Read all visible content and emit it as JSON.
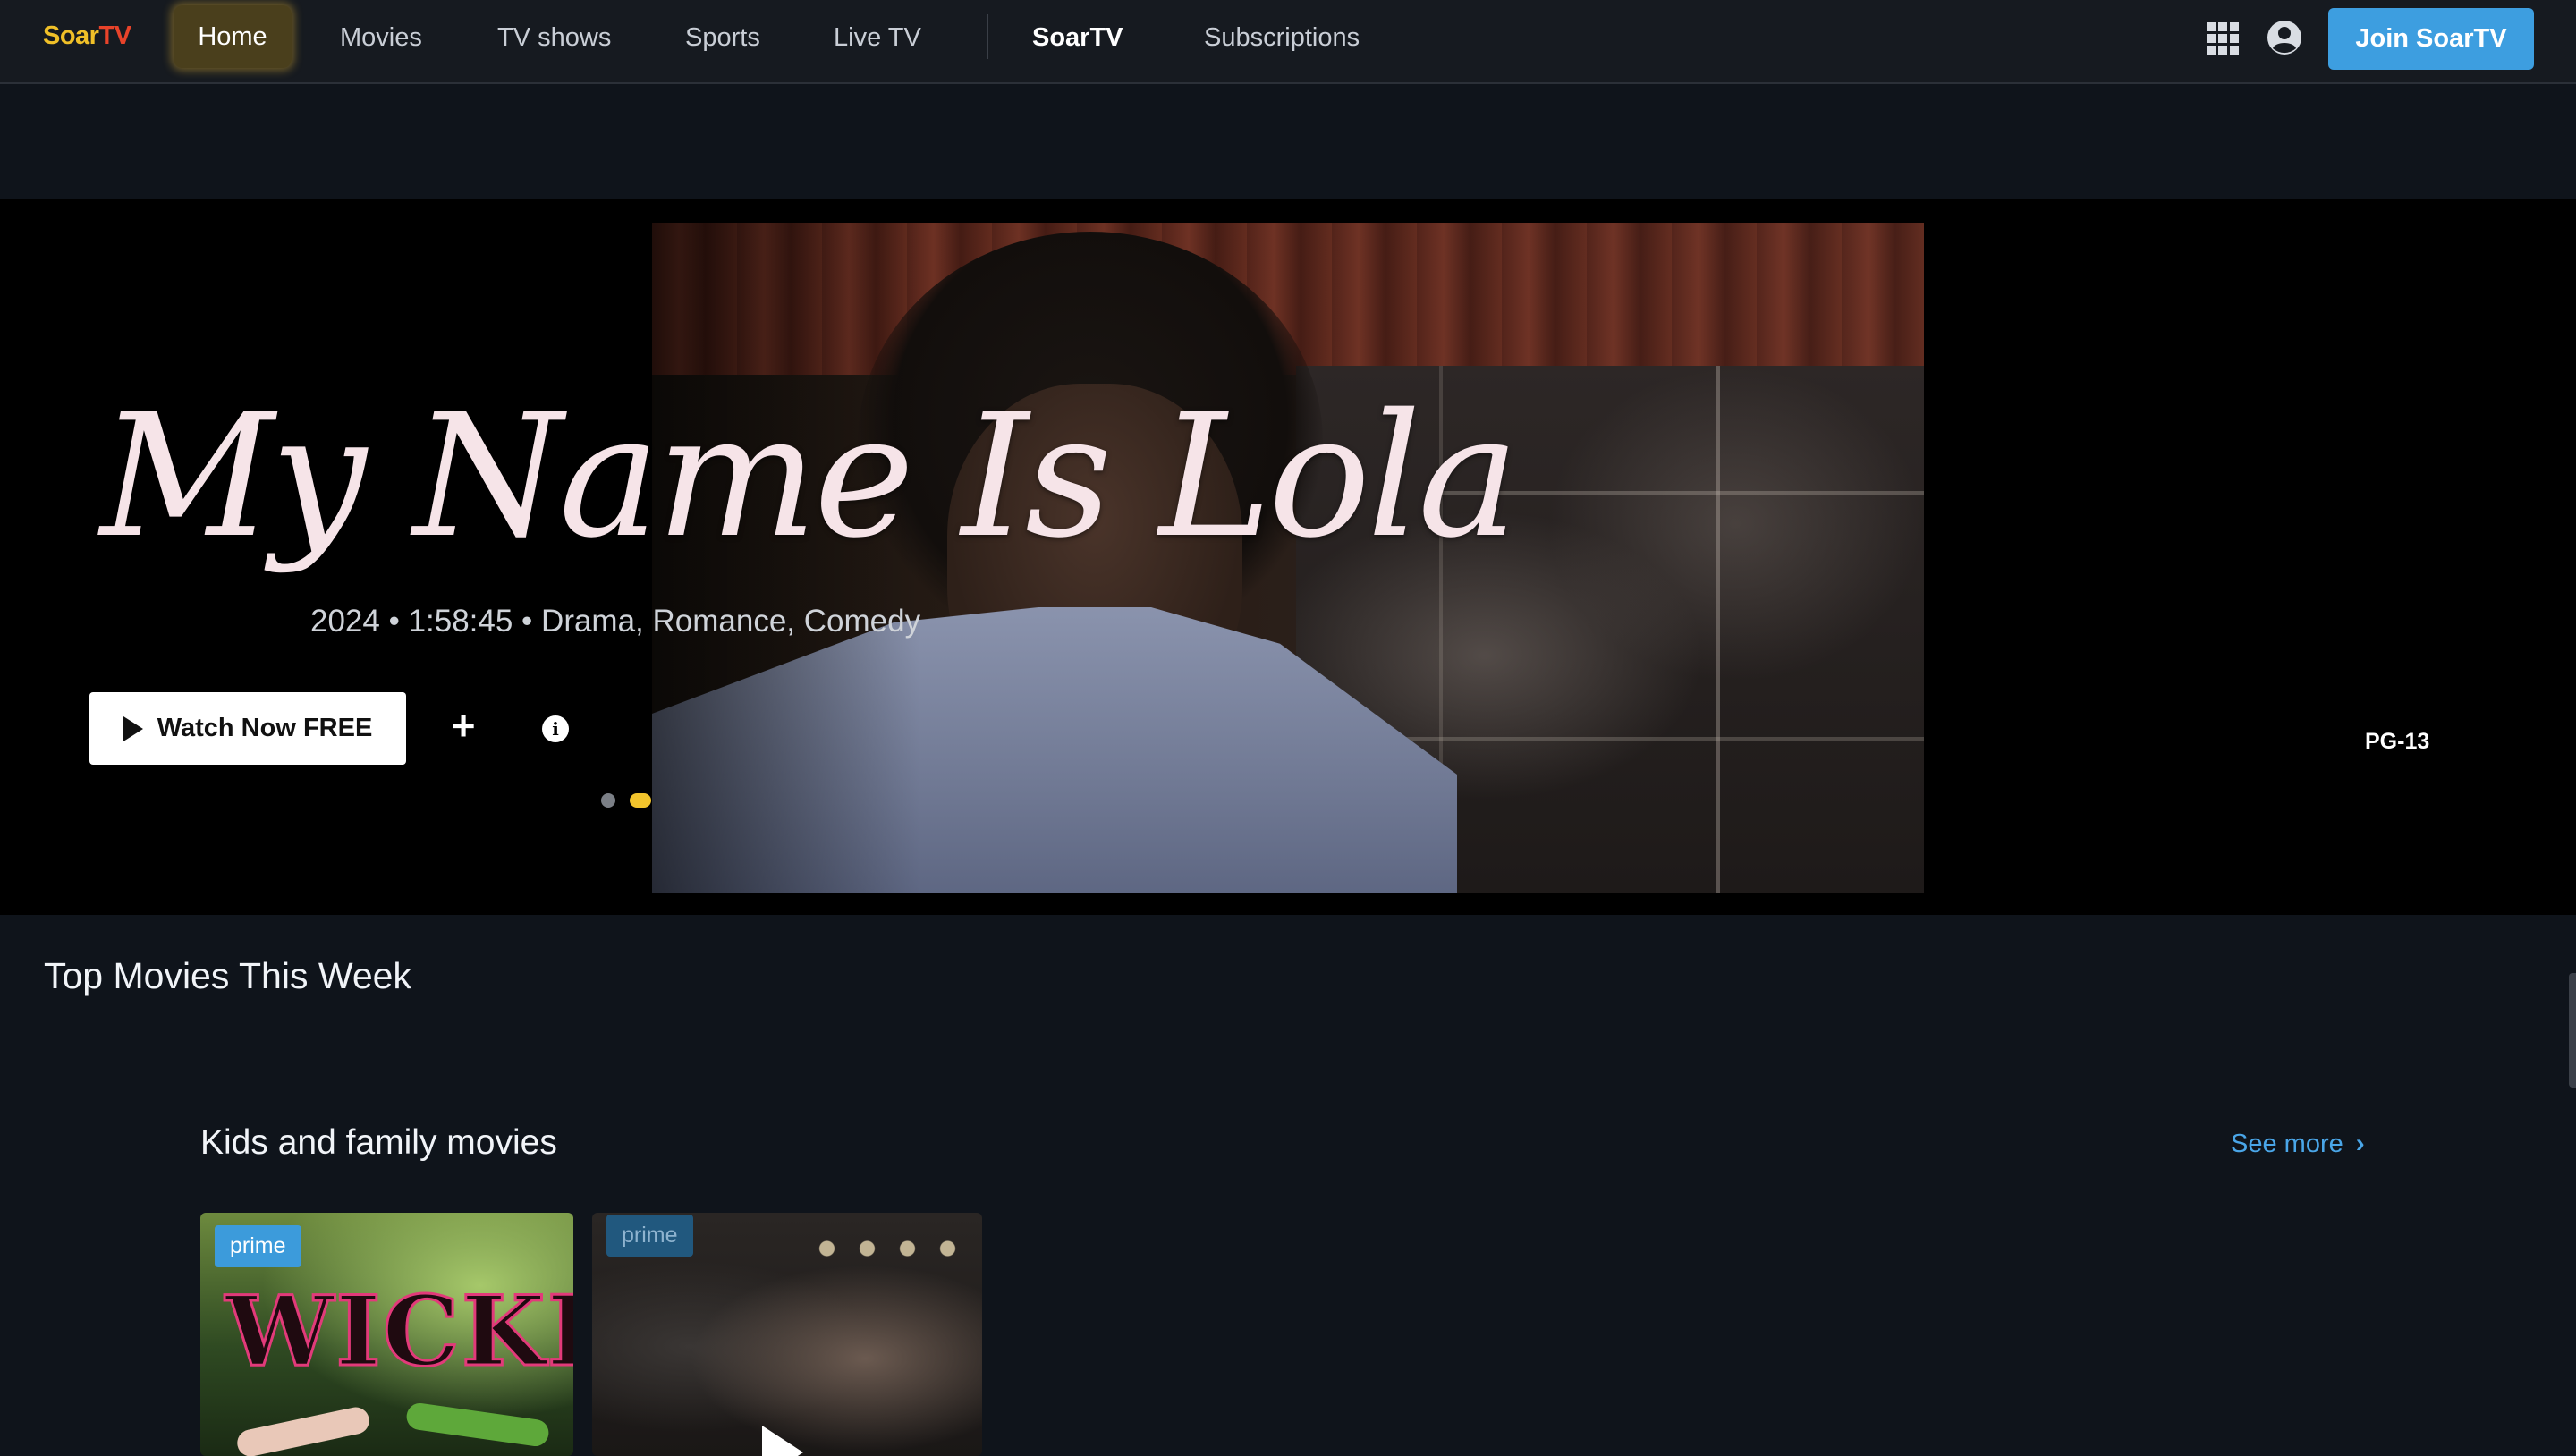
{
  "nav": {
    "logo_part1": "Soar",
    "logo_part2": "TV",
    "items": [
      "Home",
      "Movies",
      "TV shows",
      "Sports",
      "Live TV"
    ],
    "active": "Home",
    "brand": "SoarTV",
    "subscriptions": "Subscriptions",
    "join_label": "Join SoarTV",
    "icons": {
      "apps": "grid-apps-icon",
      "account": "account-circle-icon"
    }
  },
  "hero": {
    "title": "My Name Is Lola",
    "meta": "2024 • 1:58:45 • Drama, Romance, Comedy",
    "watch_label": "Watch Now FREE",
    "add_label": "+",
    "info_label": "i",
    "rating": "PG-13",
    "carousel": {
      "count": 2,
      "active_index": 1
    }
  },
  "sections": {
    "top_movies_title": "Top Movies This Week",
    "kids_row": {
      "title": "Kids and family movies",
      "see_more": "See more",
      "cards": [
        {
          "badge": "prime",
          "title": "WICKED"
        },
        {
          "badge": "prime"
        }
      ]
    }
  },
  "colors": {
    "accent_blue": "#3d9ee0",
    "logo_yellow": "#f0c028",
    "logo_red": "#e8432a",
    "carousel_active": "#f2c42c"
  }
}
